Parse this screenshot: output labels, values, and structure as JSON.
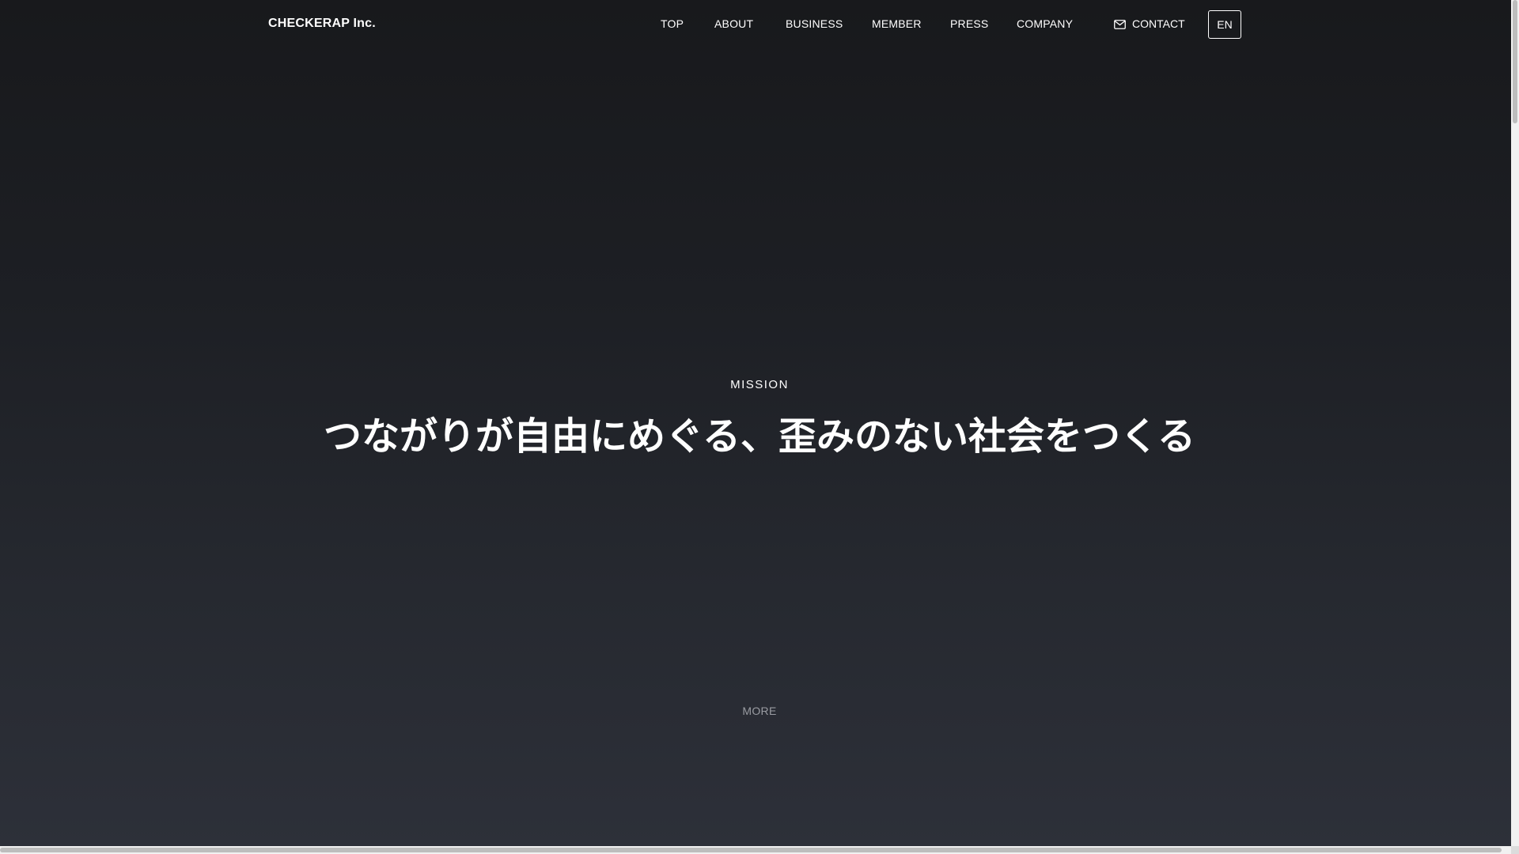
{
  "header": {
    "logo": "CHECKERAP Inc.",
    "nav": {
      "top": "TOP",
      "about": "ABOUT",
      "business": "BUSINESS",
      "member": "MEMBER",
      "press": "PRESS",
      "company": "COMPANY"
    },
    "contact_label": "CONTACT",
    "contact_icon": "mail-icon",
    "lang_label": "EN"
  },
  "hero": {
    "section_label": "MISSION",
    "statement": "つながりが自由にめぐる、歪みのない社会をつくる",
    "more_label": "MORE"
  },
  "colors": {
    "background_top": "#18191c",
    "background_bottom": "#2d3039",
    "text": "#ffffff",
    "muted_text": "#9a9ca2"
  }
}
